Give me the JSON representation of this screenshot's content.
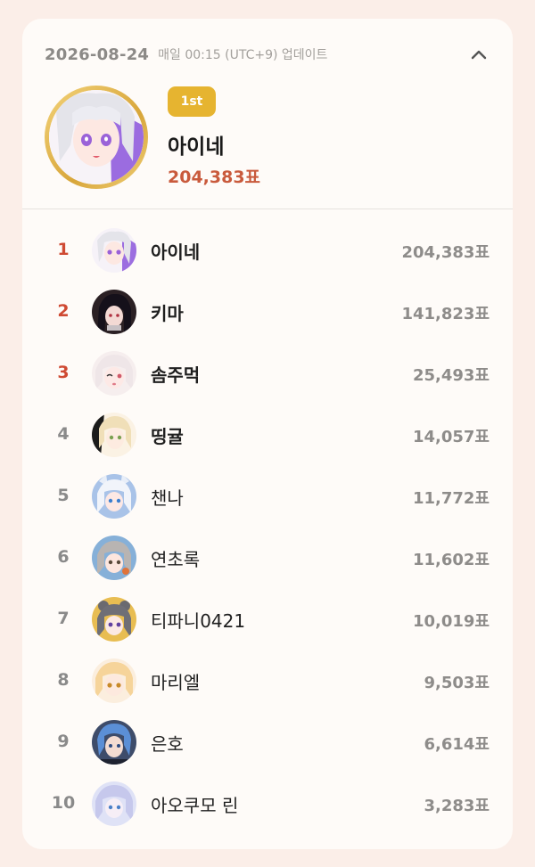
{
  "header": {
    "date": "2026-08-24",
    "update_note": "매일 00:15 (UTC+9) 업데이트"
  },
  "top": {
    "badge": "1st",
    "name": "아이네",
    "votes": "204,383표"
  },
  "rankings": [
    {
      "rank": "1",
      "name": "아이네",
      "votes": "204,383표",
      "avatar_color": "#a98ee8"
    },
    {
      "rank": "2",
      "name": "키마",
      "votes": "141,823표",
      "avatar_color": "#2a1f22"
    },
    {
      "rank": "3",
      "name": "솜주먹",
      "votes": "25,493표",
      "avatar_color": "#f3d2d3"
    },
    {
      "rank": "4",
      "name": "띵귤",
      "votes": "14,057표",
      "avatar_color": "#f1dcb9"
    },
    {
      "rank": "5",
      "name": "챈나",
      "votes": "11,772표",
      "avatar_color": "#9ab6df"
    },
    {
      "rank": "6",
      "name": "연초록",
      "votes": "11,602표",
      "avatar_color": "#8cb3d7"
    },
    {
      "rank": "7",
      "name": "티파니0421",
      "votes": "10,019표",
      "avatar_color": "#e7c15a"
    },
    {
      "rank": "8",
      "name": "마리엘",
      "votes": "9,503표",
      "avatar_color": "#f6d6a2"
    },
    {
      "rank": "9",
      "name": "은호",
      "votes": "6,614표",
      "avatar_color": "#4a5f8a"
    },
    {
      "rank": "10",
      "name": "아오쿠모 린",
      "votes": "3,283표",
      "avatar_color": "#c7d0f2"
    }
  ],
  "colors": {
    "accent_gold": "#e6b430",
    "accent_red": "#c95a3c",
    "rank_top3": "#cf4a33"
  }
}
